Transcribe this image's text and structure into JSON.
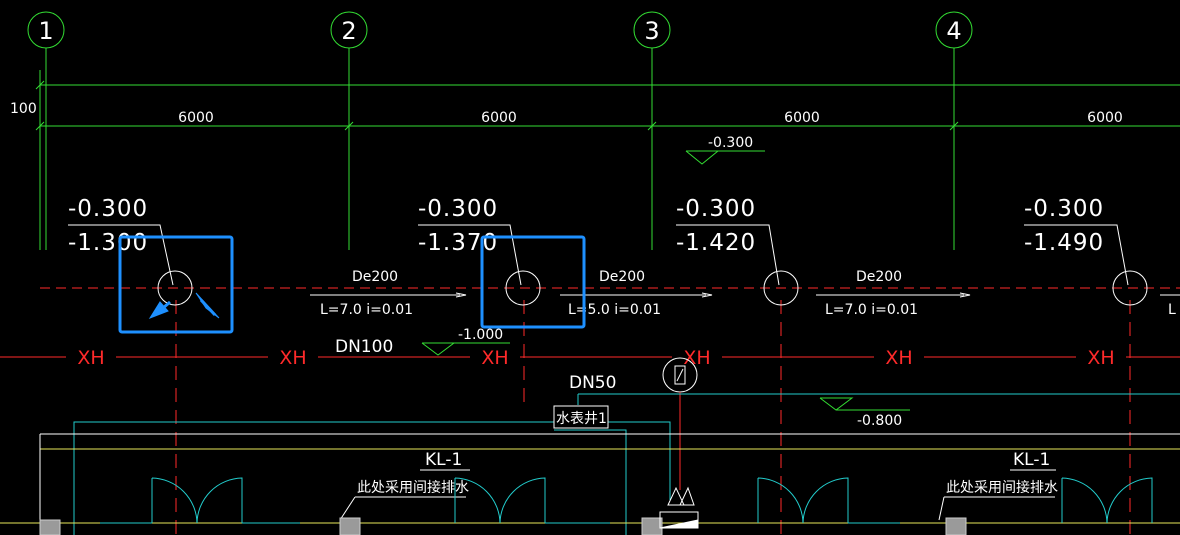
{
  "axes": [
    "1",
    "2",
    "3",
    "4"
  ],
  "top_dim": "100",
  "spans": [
    "6000",
    "6000",
    "6000",
    "6000"
  ],
  "top_level_mark": "-0.300",
  "wells": [
    {
      "top": "-0.300",
      "bottom": "-1.300"
    },
    {
      "top": "-0.300",
      "bottom": "-1.370"
    },
    {
      "top": "-0.300",
      "bottom": "-1.420"
    },
    {
      "top": "-0.300",
      "bottom": "-1.490"
    }
  ],
  "pipes": [
    {
      "size": "De200",
      "spec": "L=7.0  i=0.01"
    },
    {
      "size": "De200",
      "spec": "L=5.0  i=0.01"
    },
    {
      "size": "De200",
      "spec": "L=7.0  i=0.01"
    }
  ],
  "pipe_partial": "L",
  "xh_label": "XH",
  "dn100": "DN100",
  "level_1000": "-1.000",
  "dn50": "DN50",
  "level_0800": "-0.800",
  "meter_well": "水表井1",
  "beam": "KL-1",
  "note": "此处采用间接排水",
  "colors": {
    "grid": "#33dd33",
    "red": "#ff2a2a",
    "cyan": "#22cccc",
    "yellow": "#e8e85a",
    "highlight": "#1e90ff"
  }
}
